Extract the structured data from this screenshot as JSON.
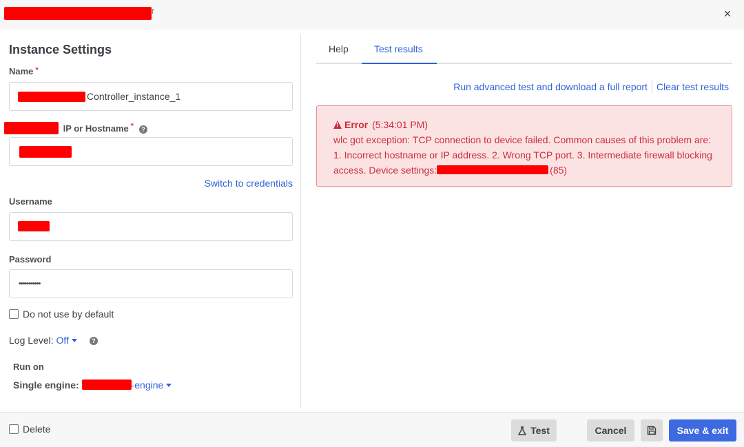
{
  "header": {
    "title_tail": "r",
    "close_label": "×"
  },
  "settings": {
    "title": "Instance Settings",
    "name_label": "Name",
    "name_value": "Controller_instance_1",
    "required_mark": "*",
    "ip_label": "IP or Hostname",
    "switch_link": "Switch to credentials",
    "username_label": "Username",
    "password_label": "Password",
    "password_value": "•••••••••••",
    "default_checkbox_label": "Do not use by default",
    "log_level_label": "Log Level:",
    "log_level_value": "Off",
    "run_on_label": "Run on",
    "engine_label": "Single engine:",
    "engine_value": "-engine"
  },
  "tabs": {
    "help": "Help",
    "results": "Test results"
  },
  "actions": {
    "advanced": "Run advanced test and download a full report",
    "clear": "Clear test results"
  },
  "error": {
    "title": "Error",
    "time": "(5:34:01 PM)",
    "message": "wlc got exception: TCP connection to device failed. Common causes of this problem are: 1. Incorrect hostname or IP address. 2. Wrong TCP port. 3. Intermediate firewall blocking access. Device settings:",
    "port_suffix": "(85)",
    "color": "#cc2c3a",
    "background": "#fbe3e4"
  },
  "footer": {
    "delete_label": "Delete",
    "test_label": "Test",
    "cancel_label": "Cancel",
    "save_exit_label": "Save & exit"
  },
  "colors": {
    "accent": "#2f63d8",
    "primary_button": "#3d6ae0",
    "redaction": "#ff0000"
  }
}
